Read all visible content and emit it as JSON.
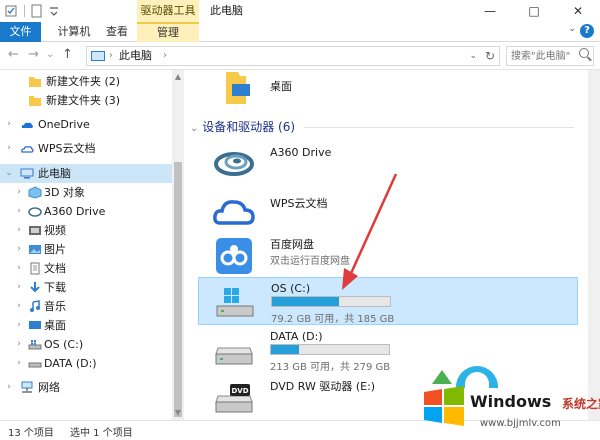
{
  "window": {
    "title": "此电脑",
    "context_tab_group": "驱动器工具",
    "controls": {
      "minimize": "—",
      "maximize": "□",
      "close": "✕"
    }
  },
  "ribbon": {
    "tabs": [
      {
        "label": "文件"
      },
      {
        "label": "计算机"
      },
      {
        "label": "查看"
      },
      {
        "label": "管理"
      }
    ],
    "help_label": "?"
  },
  "address_bar": {
    "back": "←",
    "forward": "→",
    "recent": "⌄",
    "up": "↑",
    "breadcrumb": "此电脑",
    "separator": "›",
    "search_placeholder": "搜索\"此电脑\""
  },
  "nav": {
    "items": [
      {
        "label": "新建文件夹 (2)",
        "icon": "folder-icon"
      },
      {
        "label": "新建文件夹 (3)",
        "icon": "folder-icon"
      },
      {
        "label": "OneDrive",
        "icon": "onedrive-icon"
      },
      {
        "label": "WPS云文档",
        "icon": "wps-cloud-icon"
      },
      {
        "label": "此电脑",
        "icon": "pc-icon"
      },
      {
        "label": "3D 对象",
        "icon": "3d-objects-icon"
      },
      {
        "label": "A360 Drive",
        "icon": "a360-icon"
      },
      {
        "label": "视频",
        "icon": "video-icon"
      },
      {
        "label": "图片",
        "icon": "pictures-icon"
      },
      {
        "label": "文档",
        "icon": "documents-icon"
      },
      {
        "label": "下载",
        "icon": "downloads-icon"
      },
      {
        "label": "音乐",
        "icon": "music-icon"
      },
      {
        "label": "桌面",
        "icon": "desktop-icon"
      },
      {
        "label": "OS (C:)",
        "icon": "drive-c-icon"
      },
      {
        "label": "DATA (D:)",
        "icon": "drive-d-icon"
      },
      {
        "label": "网络",
        "icon": "network-icon"
      }
    ]
  },
  "content": {
    "desktop_label": "桌面",
    "group_title": "设备和驱动器 (6)",
    "devices": [
      {
        "name": "A360 Drive",
        "icon": "a360-drive-icon"
      },
      {
        "name": "WPS云文档",
        "icon": "wps-cloud-icon"
      },
      {
        "name": "百度网盘",
        "sub": "双击运行百度网盘",
        "icon": "baidu-netdisk-icon"
      },
      {
        "name": "OS (C:)",
        "free": "79.2 GB 可用，共 185 GB",
        "used_fraction": 0.57,
        "icon": "windows-drive-icon"
      },
      {
        "name": "DATA (D:)",
        "free": "213 GB 可用，共 279 GB",
        "used_fraction": 0.24,
        "icon": "hard-drive-icon"
      },
      {
        "name": "DVD RW 驱动器 (E:)",
        "icon": "dvd-drive-icon"
      }
    ]
  },
  "status": {
    "item_count": "13 个项目",
    "selected": "选中 1 个项目"
  },
  "watermark": {
    "brand": "Windows",
    "cn": "系统之家",
    "url": "www.bjjmlv.com"
  },
  "colors": {
    "accent": "#1979ca",
    "selection": "#cce8ff",
    "bar_fill": "#26a0da",
    "context_tab": "#fdf0ba",
    "annotation_arrow": "#e03a3a"
  }
}
